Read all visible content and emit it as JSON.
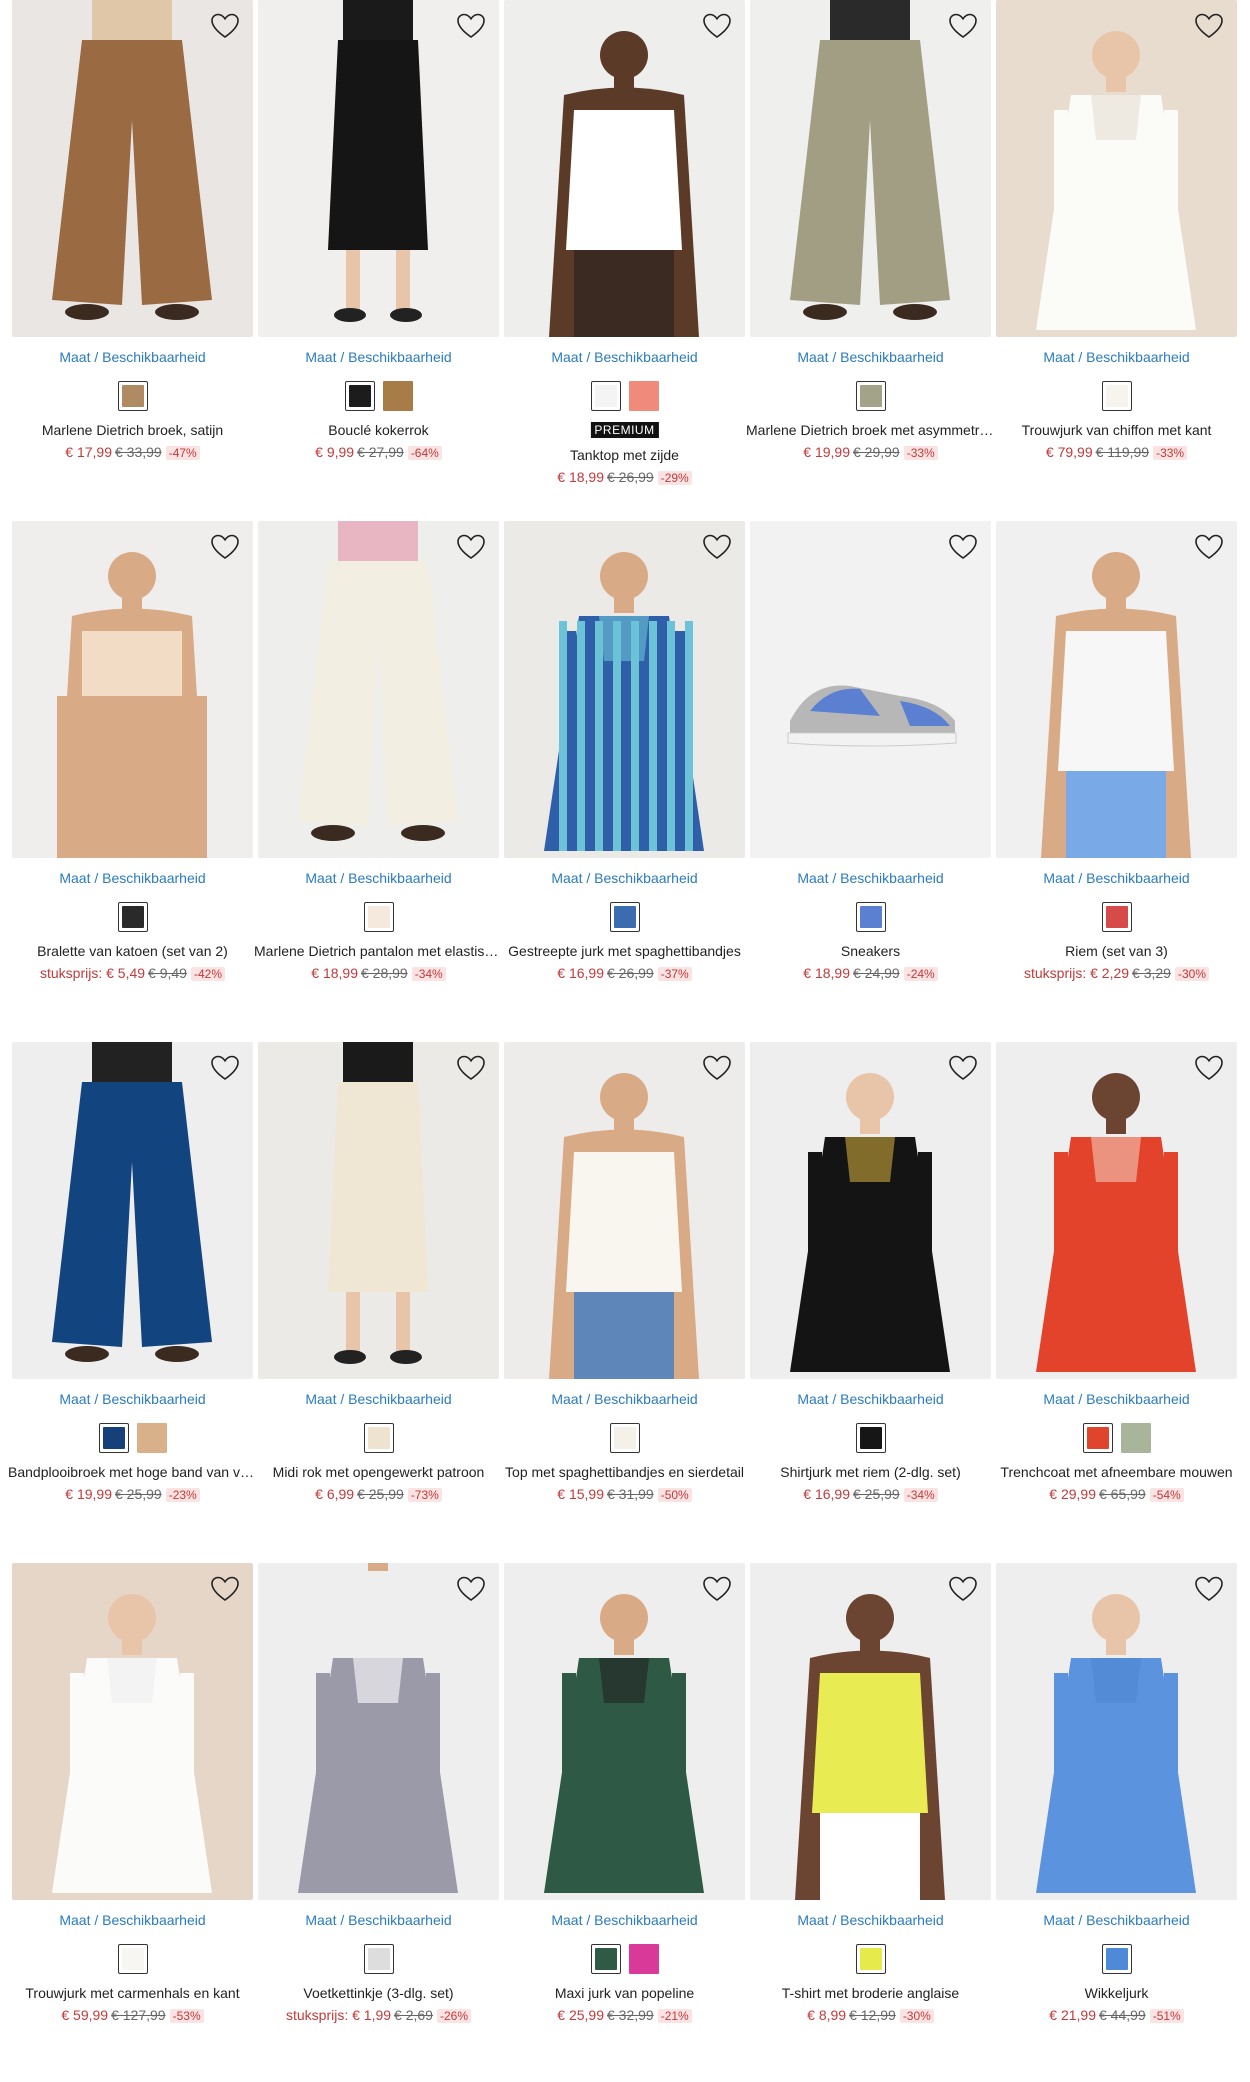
{
  "size_label": "Maat / Beschikbaarheid",
  "colors": {
    "accent_link": "#2a7bbf",
    "sale_price": "#c23a3a",
    "discount_bg": "#fbe3e3"
  },
  "products": [
    {
      "name": "Marlene Dietrich broek, satijn",
      "price": "€ 17,99",
      "old": "€ 33,99",
      "discount": "-47%",
      "icon": "leopard-trousers",
      "swatches": [
        "#b08a63"
      ],
      "badge": ""
    },
    {
      "name": "Bouclé kokerrok",
      "price": "€ 9,99",
      "old": "€ 27,99",
      "discount": "-64%",
      "icon": "black-skirt",
      "swatches": [
        "#1c1c1c",
        "#a87c46"
      ],
      "badge": ""
    },
    {
      "name": "Tanktop met zijde",
      "price": "€ 18,99",
      "old": "€ 26,99",
      "discount": "-29%",
      "icon": "white-tanktop",
      "swatches": [
        "#f4f4f4",
        "#f08a7a"
      ],
      "badge": "PREMIUM"
    },
    {
      "name": "Marlene Dietrich broek met asymmetrische sluiting",
      "price": "€ 19,99",
      "old": "€ 29,99",
      "discount": "-33%",
      "icon": "khaki-trousers",
      "swatches": [
        "#a3a38a"
      ],
      "badge": ""
    },
    {
      "name": "Trouwjurk van chiffon met kant",
      "price": "€ 79,99",
      "old": "€ 119,99",
      "discount": "-33%",
      "icon": "wedding-dress",
      "swatches": [
        "#f7f4ee"
      ],
      "badge": ""
    },
    {
      "name": "Bralette van katoen (set van 2)",
      "unit": "stuksprijs: ",
      "price": "€ 5,49",
      "old": "€ 9,49",
      "discount": "-42%",
      "icon": "bralette",
      "swatches": [
        "#2a2a2a"
      ],
      "badge": ""
    },
    {
      "name": "Marlene Dietrich pantalon met elastische band",
      "price": "€ 18,99",
      "old": "€ 28,99",
      "discount": "-34%",
      "icon": "cream-trousers",
      "swatches": [
        "#f5e8dc"
      ],
      "badge": ""
    },
    {
      "name": "Gestreepte jurk met spaghettibandjes",
      "price": "€ 16,99",
      "old": "€ 26,99",
      "discount": "-37%",
      "icon": "striped-dress",
      "swatches": [
        "#3c6cb0"
      ],
      "badge": ""
    },
    {
      "name": "Sneakers",
      "price": "€ 18,99",
      "old": "€ 24,99",
      "discount": "-24%",
      "icon": "sneaker",
      "swatches": [
        "#5b7fd1"
      ],
      "badge": ""
    },
    {
      "name": "Riem (set van 3)",
      "unit": "stuksprijs: ",
      "price": "€ 2,29",
      "old": "€ 3,29",
      "discount": "-30%",
      "icon": "belt-blouse",
      "swatches": [
        "#d64a4a"
      ],
      "badge": ""
    },
    {
      "name": "Bandplooibroek met hoge band van viscose",
      "price": "€ 19,99",
      "old": "€ 25,99",
      "discount": "-23%",
      "icon": "navy-trousers",
      "swatches": [
        "#16407a",
        "#d8b08a"
      ],
      "badge": ""
    },
    {
      "name": "Midi rok met opengewerkt patroon",
      "price": "€ 6,99",
      "old": "€ 25,99",
      "discount": "-73%",
      "icon": "crochet-skirt",
      "swatches": [
        "#ede3cf"
      ],
      "badge": ""
    },
    {
      "name": "Top met spaghettibandjes en sierdetail",
      "price": "€ 15,99",
      "old": "€ 31,99",
      "discount": "-50%",
      "icon": "white-cami",
      "swatches": [
        "#f4f1ea"
      ],
      "badge": ""
    },
    {
      "name": "Shirtjurk met riem (2-dlg. set)",
      "price": "€ 16,99",
      "old": "€ 25,99",
      "discount": "-34%",
      "icon": "black-dress",
      "swatches": [
        "#161616"
      ],
      "badge": ""
    },
    {
      "name": "Trenchcoat met afneembare mouwen",
      "price": "€ 29,99",
      "old": "€ 65,99",
      "discount": "-54%",
      "icon": "red-trenchcoat",
      "swatches": [
        "#e0442c",
        "#a8b59a"
      ],
      "badge": ""
    },
    {
      "name": "Trouwjurk met carmenhals en kant",
      "price": "€ 59,99",
      "old": "€ 127,99",
      "discount": "-53%",
      "icon": "wedding-gown",
      "swatches": [
        "#f7f6f2"
      ],
      "badge": ""
    },
    {
      "name": "Voetkettinkje (3-dlg. set)",
      "unit": "stuksprijs: ",
      "price": "€ 1,99",
      "old": "€ 2,69",
      "discount": "-26%",
      "icon": "anklet-pyjama",
      "swatches": [
        "#dddddd"
      ],
      "badge": ""
    },
    {
      "name": "Maxi jurk van popeline",
      "price": "€ 25,99",
      "old": "€ 32,99",
      "discount": "-21%",
      "icon": "green-dress",
      "swatches": [
        "#2f5a46",
        "#d93a9a"
      ],
      "badge": ""
    },
    {
      "name": "T-shirt met broderie anglaise",
      "price": "€ 8,99",
      "old": "€ 12,99",
      "discount": "-30%",
      "icon": "yellow-tshirt",
      "swatches": [
        "#e6ea4a"
      ],
      "badge": ""
    },
    {
      "name": "Wikkeljurk",
      "price": "€ 21,99",
      "old": "€ 44,99",
      "discount": "-51%",
      "icon": "blue-wrap-dress",
      "swatches": [
        "#4f8ad8"
      ],
      "badge": ""
    }
  ]
}
